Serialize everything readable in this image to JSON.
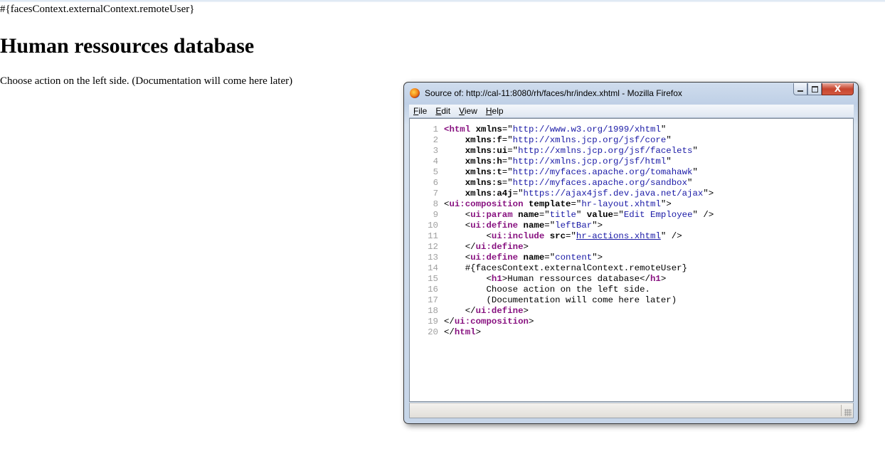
{
  "page": {
    "remote_user_expr": "#{facesContext.externalContext.remoteUser}",
    "title": "Human ressources database",
    "intro": "Choose action on the left side. (Documentation will come here later)"
  },
  "window": {
    "title": "Source of: http://cal-11:8080/rh/faces/hr/index.xhtml - Mozilla Firefox",
    "icon": "firefox-icon",
    "buttons": [
      "minimize",
      "maximize",
      "close"
    ],
    "close_glyph": "X",
    "menu": [
      {
        "accel": "F",
        "rest": "ile"
      },
      {
        "accel": "E",
        "rest": "dit"
      },
      {
        "accel": "V",
        "rest": "iew"
      },
      {
        "accel": "H",
        "rest": "elp"
      }
    ]
  },
  "source_lines": [
    [
      {
        "t": "<",
        "c": "tag"
      },
      {
        "t": "html",
        "c": "tag"
      },
      {
        "t": " xmlns",
        "c": "attr"
      },
      {
        "t": "=\"",
        "c": "txt"
      },
      {
        "t": "http://www.w3.org/1999/xhtml",
        "c": "val"
      },
      {
        "t": "\"",
        "c": "txt"
      }
    ],
    [
      {
        "t": "    xmlns:f",
        "c": "attr"
      },
      {
        "t": "=\"",
        "c": "txt"
      },
      {
        "t": "http://xmlns.jcp.org/jsf/core",
        "c": "val"
      },
      {
        "t": "\"",
        "c": "txt"
      }
    ],
    [
      {
        "t": "    xmlns:ui",
        "c": "attr"
      },
      {
        "t": "=\"",
        "c": "txt"
      },
      {
        "t": "http://xmlns.jcp.org/jsf/facelets",
        "c": "val"
      },
      {
        "t": "\"",
        "c": "txt"
      }
    ],
    [
      {
        "t": "    xmlns:h",
        "c": "attr"
      },
      {
        "t": "=\"",
        "c": "txt"
      },
      {
        "t": "http://xmlns.jcp.org/jsf/html",
        "c": "val"
      },
      {
        "t": "\"",
        "c": "txt"
      }
    ],
    [
      {
        "t": "    xmlns:t",
        "c": "attr"
      },
      {
        "t": "=\"",
        "c": "txt"
      },
      {
        "t": "http://myfaces.apache.org/tomahawk",
        "c": "val"
      },
      {
        "t": "\"",
        "c": "txt"
      }
    ],
    [
      {
        "t": "    xmlns:s",
        "c": "attr"
      },
      {
        "t": "=\"",
        "c": "txt"
      },
      {
        "t": "http://myfaces.apache.org/sandbox",
        "c": "val"
      },
      {
        "t": "\"",
        "c": "txt"
      }
    ],
    [
      {
        "t": "    xmlns:a4j",
        "c": "attr"
      },
      {
        "t": "=\"",
        "c": "txt"
      },
      {
        "t": "https://ajax4jsf.dev.java.net/ajax",
        "c": "val"
      },
      {
        "t": "\">",
        "c": "txt"
      }
    ],
    [
      {
        "t": "<",
        "c": "txt"
      },
      {
        "t": "ui:composition",
        "c": "tag"
      },
      {
        "t": " template",
        "c": "attr"
      },
      {
        "t": "=\"",
        "c": "txt"
      },
      {
        "t": "hr-layout.xhtml",
        "c": "val"
      },
      {
        "t": "\">",
        "c": "txt"
      }
    ],
    [
      {
        "t": "    <",
        "c": "txt"
      },
      {
        "t": "ui:param",
        "c": "tag"
      },
      {
        "t": " name",
        "c": "attr"
      },
      {
        "t": "=\"",
        "c": "txt"
      },
      {
        "t": "title",
        "c": "val"
      },
      {
        "t": "\"",
        "c": "txt"
      },
      {
        "t": " value",
        "c": "attr"
      },
      {
        "t": "=\"",
        "c": "txt"
      },
      {
        "t": "Edit Employee",
        "c": "val"
      },
      {
        "t": "\" />",
        "c": "txt"
      }
    ],
    [
      {
        "t": "    <",
        "c": "txt"
      },
      {
        "t": "ui:define",
        "c": "tag"
      },
      {
        "t": " name",
        "c": "attr"
      },
      {
        "t": "=\"",
        "c": "txt"
      },
      {
        "t": "leftBar",
        "c": "val"
      },
      {
        "t": "\">",
        "c": "txt"
      }
    ],
    [
      {
        "t": "        <",
        "c": "txt"
      },
      {
        "t": "ui:include",
        "c": "tag"
      },
      {
        "t": " src",
        "c": "attr"
      },
      {
        "t": "=\"",
        "c": "txt"
      },
      {
        "t": "hr-actions.xhtml",
        "c": "lnk"
      },
      {
        "t": "\" />",
        "c": "txt"
      }
    ],
    [
      {
        "t": "    </",
        "c": "txt"
      },
      {
        "t": "ui:define",
        "c": "tag"
      },
      {
        "t": ">",
        "c": "txt"
      }
    ],
    [
      {
        "t": "    <",
        "c": "txt"
      },
      {
        "t": "ui:define",
        "c": "tag"
      },
      {
        "t": " name",
        "c": "attr"
      },
      {
        "t": "=\"",
        "c": "txt"
      },
      {
        "t": "content",
        "c": "val"
      },
      {
        "t": "\">",
        "c": "txt"
      }
    ],
    [
      {
        "t": "    #{facesContext.externalContext.remoteUser}",
        "c": "txt"
      }
    ],
    [
      {
        "t": "        <",
        "c": "txt"
      },
      {
        "t": "h1",
        "c": "tag"
      },
      {
        "t": ">Human ressources database</",
        "c": "txt"
      },
      {
        "t": "h1",
        "c": "tag"
      },
      {
        "t": ">",
        "c": "txt"
      }
    ],
    [
      {
        "t": "        Choose action on the left side.",
        "c": "txt"
      }
    ],
    [
      {
        "t": "        (Documentation will come here later)",
        "c": "txt"
      }
    ],
    [
      {
        "t": "    </",
        "c": "txt"
      },
      {
        "t": "ui:define",
        "c": "tag"
      },
      {
        "t": ">",
        "c": "txt"
      }
    ],
    [
      {
        "t": "</",
        "c": "txt"
      },
      {
        "t": "ui:composition",
        "c": "tag"
      },
      {
        "t": ">",
        "c": "txt"
      }
    ],
    [
      {
        "t": "</",
        "c": "txt"
      },
      {
        "t": "html",
        "c": "tag"
      },
      {
        "t": ">",
        "c": "txt"
      }
    ]
  ]
}
